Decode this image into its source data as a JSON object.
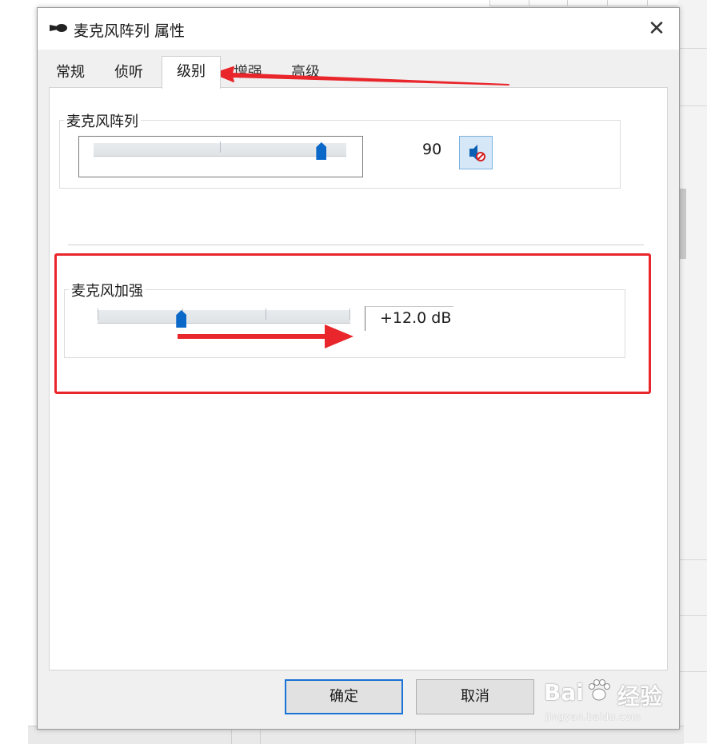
{
  "dialog": {
    "title": "麦克风阵列 属性",
    "close_glyph": "✕",
    "tabs": [
      {
        "label": "常规"
      },
      {
        "label": "侦听"
      },
      {
        "label": "级别"
      },
      {
        "label": "增强"
      },
      {
        "label": "高级"
      }
    ],
    "active_tab": "级别",
    "mic_array": {
      "group_label": "麦克风阵列",
      "level_value": "90",
      "slider_level_percent": 90,
      "mute_icon": "speaker-muted-icon"
    },
    "mic_boost": {
      "group_label": "麦克风加强",
      "value": "+12.0 dB",
      "slider_level_fraction": 0.33
    },
    "buttons": {
      "ok": "确定",
      "cancel": "取消"
    }
  },
  "watermark": {
    "brand": "Bai",
    "brand2": "经验",
    "sub": "jingyan.baidu.com"
  },
  "colors": {
    "accent_blue": "#0a68c8",
    "highlight_red": "#e9262b",
    "dialog_bg": "#f0f0f0"
  }
}
